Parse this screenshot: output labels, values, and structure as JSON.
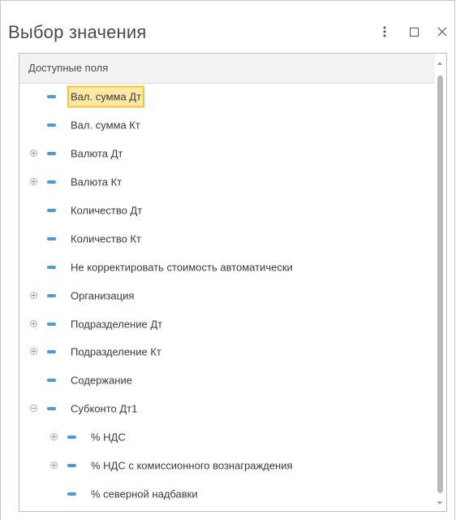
{
  "window": {
    "title": "Выбор значения",
    "buttons": {
      "more": "more-vertical-icon",
      "maximize": "maximize-icon",
      "close": "close-icon"
    }
  },
  "panel": {
    "header": "Доступные поля",
    "rows": [
      {
        "label": "Вал. сумма Дт",
        "level": 0,
        "expander": "none",
        "selected": true
      },
      {
        "label": "Вал. сумма Кт",
        "level": 0,
        "expander": "none"
      },
      {
        "label": "Валюта Дт",
        "level": 0,
        "expander": "plus"
      },
      {
        "label": "Валюта Кт",
        "level": 0,
        "expander": "plus"
      },
      {
        "label": "Количество Дт",
        "level": 0,
        "expander": "none"
      },
      {
        "label": "Количество Кт",
        "level": 0,
        "expander": "none"
      },
      {
        "label": "Не корректировать стоимость автоматически",
        "level": 0,
        "expander": "none"
      },
      {
        "label": "Организация",
        "level": 0,
        "expander": "plus"
      },
      {
        "label": "Подразделение Дт",
        "level": 0,
        "expander": "plus"
      },
      {
        "label": "Подразделение Кт",
        "level": 0,
        "expander": "plus"
      },
      {
        "label": "Содержание",
        "level": 0,
        "expander": "none"
      },
      {
        "label": "Субконто Дт1",
        "level": 0,
        "expander": "minus"
      },
      {
        "label": "% НДС",
        "level": 1,
        "expander": "plus"
      },
      {
        "label": "% НДС с комиссионного вознаграждения",
        "level": 1,
        "expander": "plus"
      },
      {
        "label": "% северной надбавки",
        "level": 1,
        "expander": "none"
      }
    ]
  },
  "colors": {
    "field_icon": "#4d9ad6",
    "selection_fill": "#fce9a6",
    "selection_border": "#f4c33d"
  }
}
